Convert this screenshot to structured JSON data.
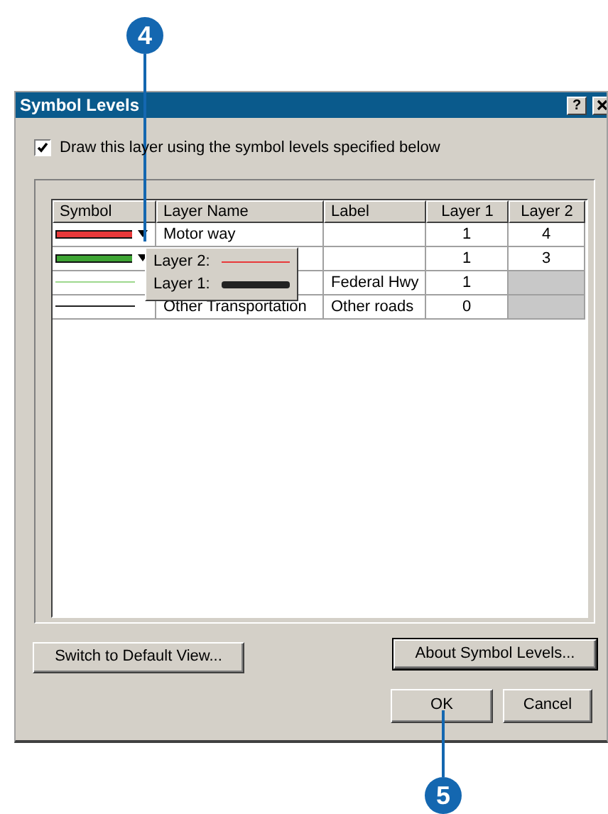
{
  "callouts": [
    {
      "number": "4"
    },
    {
      "number": "5"
    }
  ],
  "window": {
    "title": "Symbol Levels",
    "help": "?"
  },
  "checkbox": {
    "label": "Draw this layer using the symbol levels specified below",
    "checked": true
  },
  "table": {
    "columns": [
      "Symbol",
      "Layer Name",
      "Label",
      "Layer 1",
      "Layer 2"
    ],
    "rows": [
      {
        "symbol": {
          "kind": "cased",
          "color": "#e8393a"
        },
        "dropdown": true,
        "name": "Motor way",
        "layer_1": "1",
        "layer_2": {
          "value": "4",
          "disabled": false
        }
      },
      {
        "symbol": {
          "kind": "cased",
          "color": "#3fa535"
        },
        "dropdown": true,
        "layer_1": "1",
        "layer_2": {
          "value": "3",
          "disabled": false
        }
      },
      {
        "symbol": {
          "kind": "thin",
          "color": "#9ed88e"
        },
        "dropdown": false,
        "label": "Federal Hwy",
        "layer_1": "1",
        "layer_2": {
          "disabled": true
        }
      },
      {
        "symbol": {
          "kind": "thin",
          "color": "#222222"
        },
        "dropdown": false,
        "name": "Other Transportation",
        "label": "Other roads",
        "layer_1": "0",
        "layer_2": {
          "disabled": true
        }
      }
    ]
  },
  "popup": {
    "items": [
      {
        "label": "Layer 2:",
        "kind": "thin",
        "color": "#e8393a"
      },
      {
        "label": "Layer 1:",
        "kind": "thick",
        "color": "#222222"
      }
    ]
  },
  "buttons": {
    "switch": "Switch to Default View...",
    "about": "About Symbol Levels...",
    "ok": "OK",
    "cancel": "Cancel"
  }
}
